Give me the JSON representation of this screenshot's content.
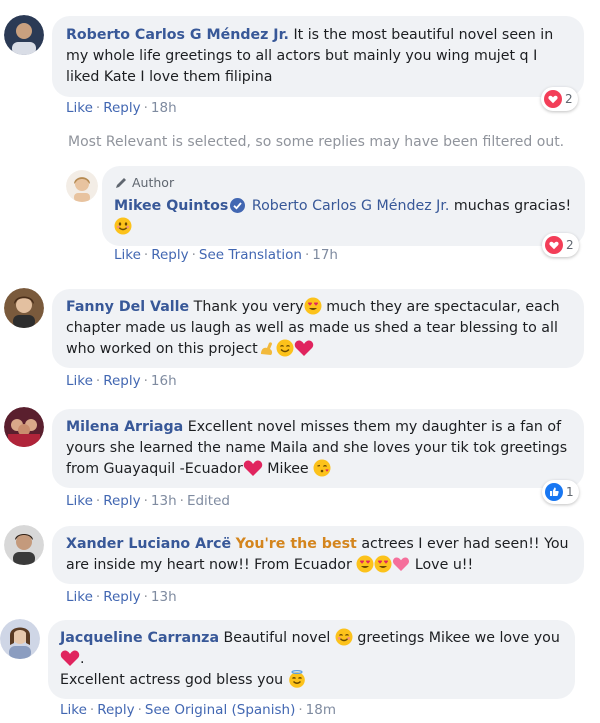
{
  "action_labels": {
    "like": "Like",
    "reply": "Reply",
    "see_translation": "See Translation",
    "see_original": "See Original (Spanish)",
    "edited": "Edited"
  },
  "filter_note": "Most Relevant is selected, so some replies may have been filtered out.",
  "comments": [
    {
      "author": "Roberto Carlos G Méndez Jr.",
      "text": "It is the most beautiful novel seen in my whole life greetings to all actors but mainly you wing mujet q I liked Kate I love them filipina",
      "time": "18h",
      "reaction_count": "2",
      "reaction_icon": "heart-icon"
    },
    {
      "author": "Mikee Quintos",
      "author_tag": "Author",
      "mention": "Roberto Carlos G Méndez Jr.",
      "text": "muchas gracias!",
      "time": "17h",
      "reaction_count": "2",
      "reaction_icon": "heart-icon"
    },
    {
      "author": "Fanny Del Valle",
      "text_1": "Thank you very",
      "text_2": "much they are spectacular, each chapter made us laugh as well as made us shed a tear blessing to all who worked on this project",
      "time": "16h"
    },
    {
      "author": "Milena Arriaga",
      "text_1": "Excellent novel misses them my daughter is a fan of yours she learned the name Maila and she loves your tik tok greetings from Guayaquil -Ecuador",
      "text_2": "Mikee",
      "time": "13h",
      "reaction_count": "1",
      "reaction_icon": "like-icon"
    },
    {
      "author": "Xander Luciano Arcë",
      "highlight": "You're the best",
      "text_1": "actrees I ever had seen!! You are inside my heart now!! From Ecuador",
      "text_2": "Love u!!",
      "time": "13h"
    },
    {
      "author": "Jacqueline Carranza",
      "text_1": "Beautiful novel",
      "text_2": "greetings Mikee we love you",
      "text_3": "Excellent actress god bless you",
      "time": "18m"
    }
  ],
  "colors": {
    "link_blue": "#385898",
    "action_blue": "#4267b2",
    "bubble_bg": "#f0f2f5",
    "heart_red": "#f33e58",
    "highlight_orange": "#d4851d"
  }
}
